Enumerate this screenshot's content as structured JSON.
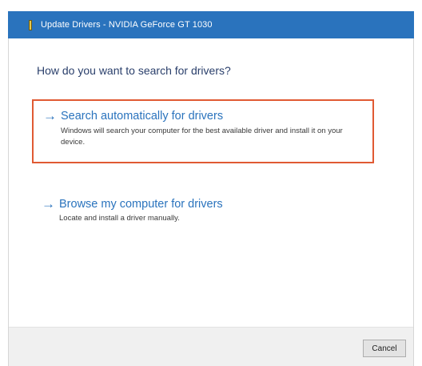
{
  "window": {
    "title": "Update Drivers - NVIDIA GeForce GT 1030",
    "accent_color": "#2a73bd",
    "highlight_color": "#e05a33"
  },
  "main": {
    "heading": "How do you want to search for drivers?",
    "options": [
      {
        "arrow_icon": "→",
        "title": "Search automatically for drivers",
        "description": "Windows will search your computer for the best available driver and install it on your device.",
        "highlighted": true
      },
      {
        "arrow_icon": "→",
        "title": "Browse my computer for drivers",
        "description": "Locate and install a driver manually.",
        "highlighted": false
      }
    ]
  },
  "footer": {
    "cancel_label": "Cancel"
  }
}
